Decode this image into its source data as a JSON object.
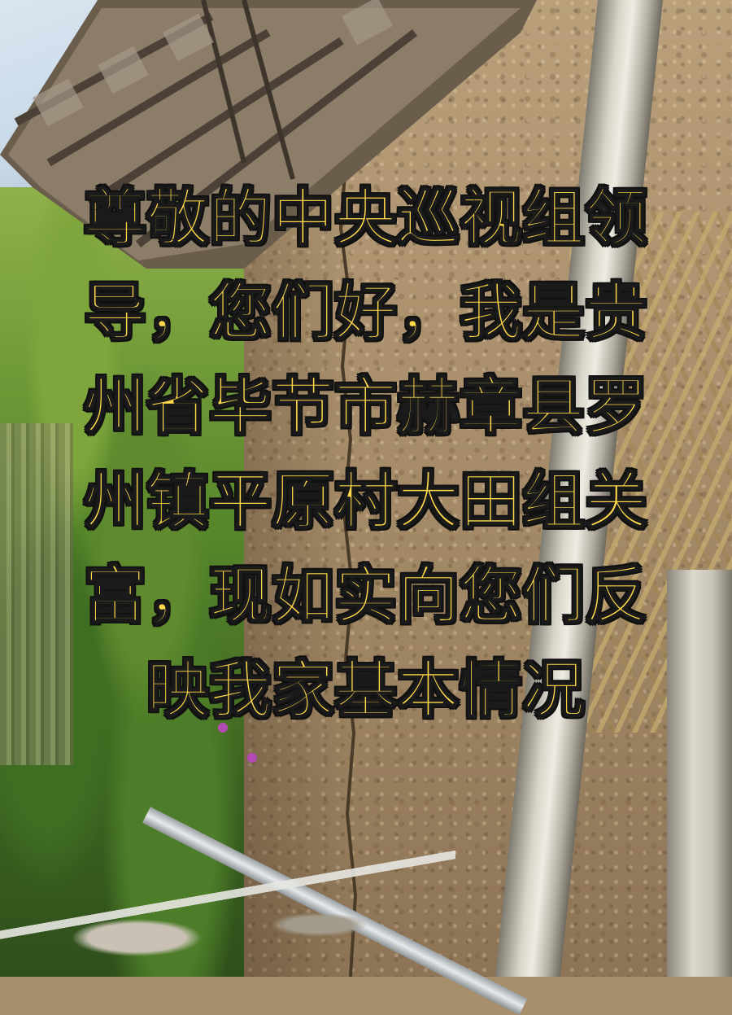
{
  "caption": {
    "lines": [
      "尊敬的中央巡视组领",
      "导，您们好，我是贵",
      "州省毕节市赫章县罗",
      "州镇平原村大田组关",
      "富，现如实向您们反",
      "映我家基本情况"
    ],
    "color": "#ffd94a",
    "outline_color": "#111111"
  }
}
